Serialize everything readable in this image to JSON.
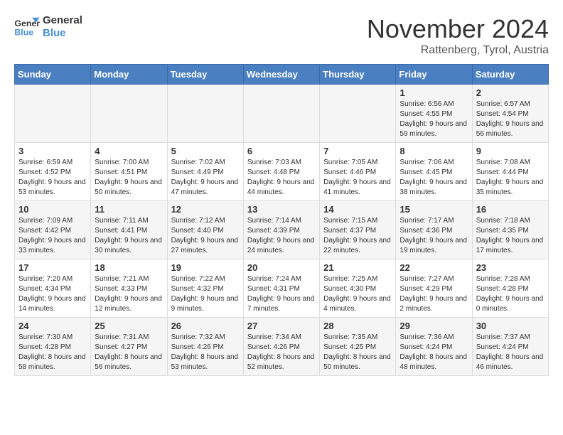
{
  "header": {
    "logo_line1": "General",
    "logo_line2": "Blue",
    "month": "November 2024",
    "location": "Rattenberg, Tyrol, Austria"
  },
  "weekdays": [
    "Sunday",
    "Monday",
    "Tuesday",
    "Wednesday",
    "Thursday",
    "Friday",
    "Saturday"
  ],
  "weeks": [
    [
      {
        "day": "",
        "info": ""
      },
      {
        "day": "",
        "info": ""
      },
      {
        "day": "",
        "info": ""
      },
      {
        "day": "",
        "info": ""
      },
      {
        "day": "",
        "info": ""
      },
      {
        "day": "1",
        "info": "Sunrise: 6:56 AM\nSunset: 4:55 PM\nDaylight: 9 hours and 59 minutes."
      },
      {
        "day": "2",
        "info": "Sunrise: 6:57 AM\nSunset: 4:54 PM\nDaylight: 9 hours and 56 minutes."
      }
    ],
    [
      {
        "day": "3",
        "info": "Sunrise: 6:59 AM\nSunset: 4:52 PM\nDaylight: 9 hours and 53 minutes."
      },
      {
        "day": "4",
        "info": "Sunrise: 7:00 AM\nSunset: 4:51 PM\nDaylight: 9 hours and 50 minutes."
      },
      {
        "day": "5",
        "info": "Sunrise: 7:02 AM\nSunset: 4:49 PM\nDaylight: 9 hours and 47 minutes."
      },
      {
        "day": "6",
        "info": "Sunrise: 7:03 AM\nSunset: 4:48 PM\nDaylight: 9 hours and 44 minutes."
      },
      {
        "day": "7",
        "info": "Sunrise: 7:05 AM\nSunset: 4:46 PM\nDaylight: 9 hours and 41 minutes."
      },
      {
        "day": "8",
        "info": "Sunrise: 7:06 AM\nSunset: 4:45 PM\nDaylight: 9 hours and 38 minutes."
      },
      {
        "day": "9",
        "info": "Sunrise: 7:08 AM\nSunset: 4:44 PM\nDaylight: 9 hours and 35 minutes."
      }
    ],
    [
      {
        "day": "10",
        "info": "Sunrise: 7:09 AM\nSunset: 4:42 PM\nDaylight: 9 hours and 33 minutes."
      },
      {
        "day": "11",
        "info": "Sunrise: 7:11 AM\nSunset: 4:41 PM\nDaylight: 9 hours and 30 minutes."
      },
      {
        "day": "12",
        "info": "Sunrise: 7:12 AM\nSunset: 4:40 PM\nDaylight: 9 hours and 27 minutes."
      },
      {
        "day": "13",
        "info": "Sunrise: 7:14 AM\nSunset: 4:39 PM\nDaylight: 9 hours and 24 minutes."
      },
      {
        "day": "14",
        "info": "Sunrise: 7:15 AM\nSunset: 4:37 PM\nDaylight: 9 hours and 22 minutes."
      },
      {
        "day": "15",
        "info": "Sunrise: 7:17 AM\nSunset: 4:36 PM\nDaylight: 9 hours and 19 minutes."
      },
      {
        "day": "16",
        "info": "Sunrise: 7:18 AM\nSunset: 4:35 PM\nDaylight: 9 hours and 17 minutes."
      }
    ],
    [
      {
        "day": "17",
        "info": "Sunrise: 7:20 AM\nSunset: 4:34 PM\nDaylight: 9 hours and 14 minutes."
      },
      {
        "day": "18",
        "info": "Sunrise: 7:21 AM\nSunset: 4:33 PM\nDaylight: 9 hours and 12 minutes."
      },
      {
        "day": "19",
        "info": "Sunrise: 7:22 AM\nSunset: 4:32 PM\nDaylight: 9 hours and 9 minutes."
      },
      {
        "day": "20",
        "info": "Sunrise: 7:24 AM\nSunset: 4:31 PM\nDaylight: 9 hours and 7 minutes."
      },
      {
        "day": "21",
        "info": "Sunrise: 7:25 AM\nSunset: 4:30 PM\nDaylight: 9 hours and 4 minutes."
      },
      {
        "day": "22",
        "info": "Sunrise: 7:27 AM\nSunset: 4:29 PM\nDaylight: 9 hours and 2 minutes."
      },
      {
        "day": "23",
        "info": "Sunrise: 7:28 AM\nSunset: 4:28 PM\nDaylight: 9 hours and 0 minutes."
      }
    ],
    [
      {
        "day": "24",
        "info": "Sunrise: 7:30 AM\nSunset: 4:28 PM\nDaylight: 8 hours and 58 minutes."
      },
      {
        "day": "25",
        "info": "Sunrise: 7:31 AM\nSunset: 4:27 PM\nDaylight: 8 hours and 56 minutes."
      },
      {
        "day": "26",
        "info": "Sunrise: 7:32 AM\nSunset: 4:26 PM\nDaylight: 8 hours and 53 minutes."
      },
      {
        "day": "27",
        "info": "Sunrise: 7:34 AM\nSunset: 4:26 PM\nDaylight: 8 hours and 52 minutes."
      },
      {
        "day": "28",
        "info": "Sunrise: 7:35 AM\nSunset: 4:25 PM\nDaylight: 8 hours and 50 minutes."
      },
      {
        "day": "29",
        "info": "Sunrise: 7:36 AM\nSunset: 4:24 PM\nDaylight: 8 hours and 48 minutes."
      },
      {
        "day": "30",
        "info": "Sunrise: 7:37 AM\nSunset: 4:24 PM\nDaylight: 8 hours and 46 minutes."
      }
    ]
  ]
}
